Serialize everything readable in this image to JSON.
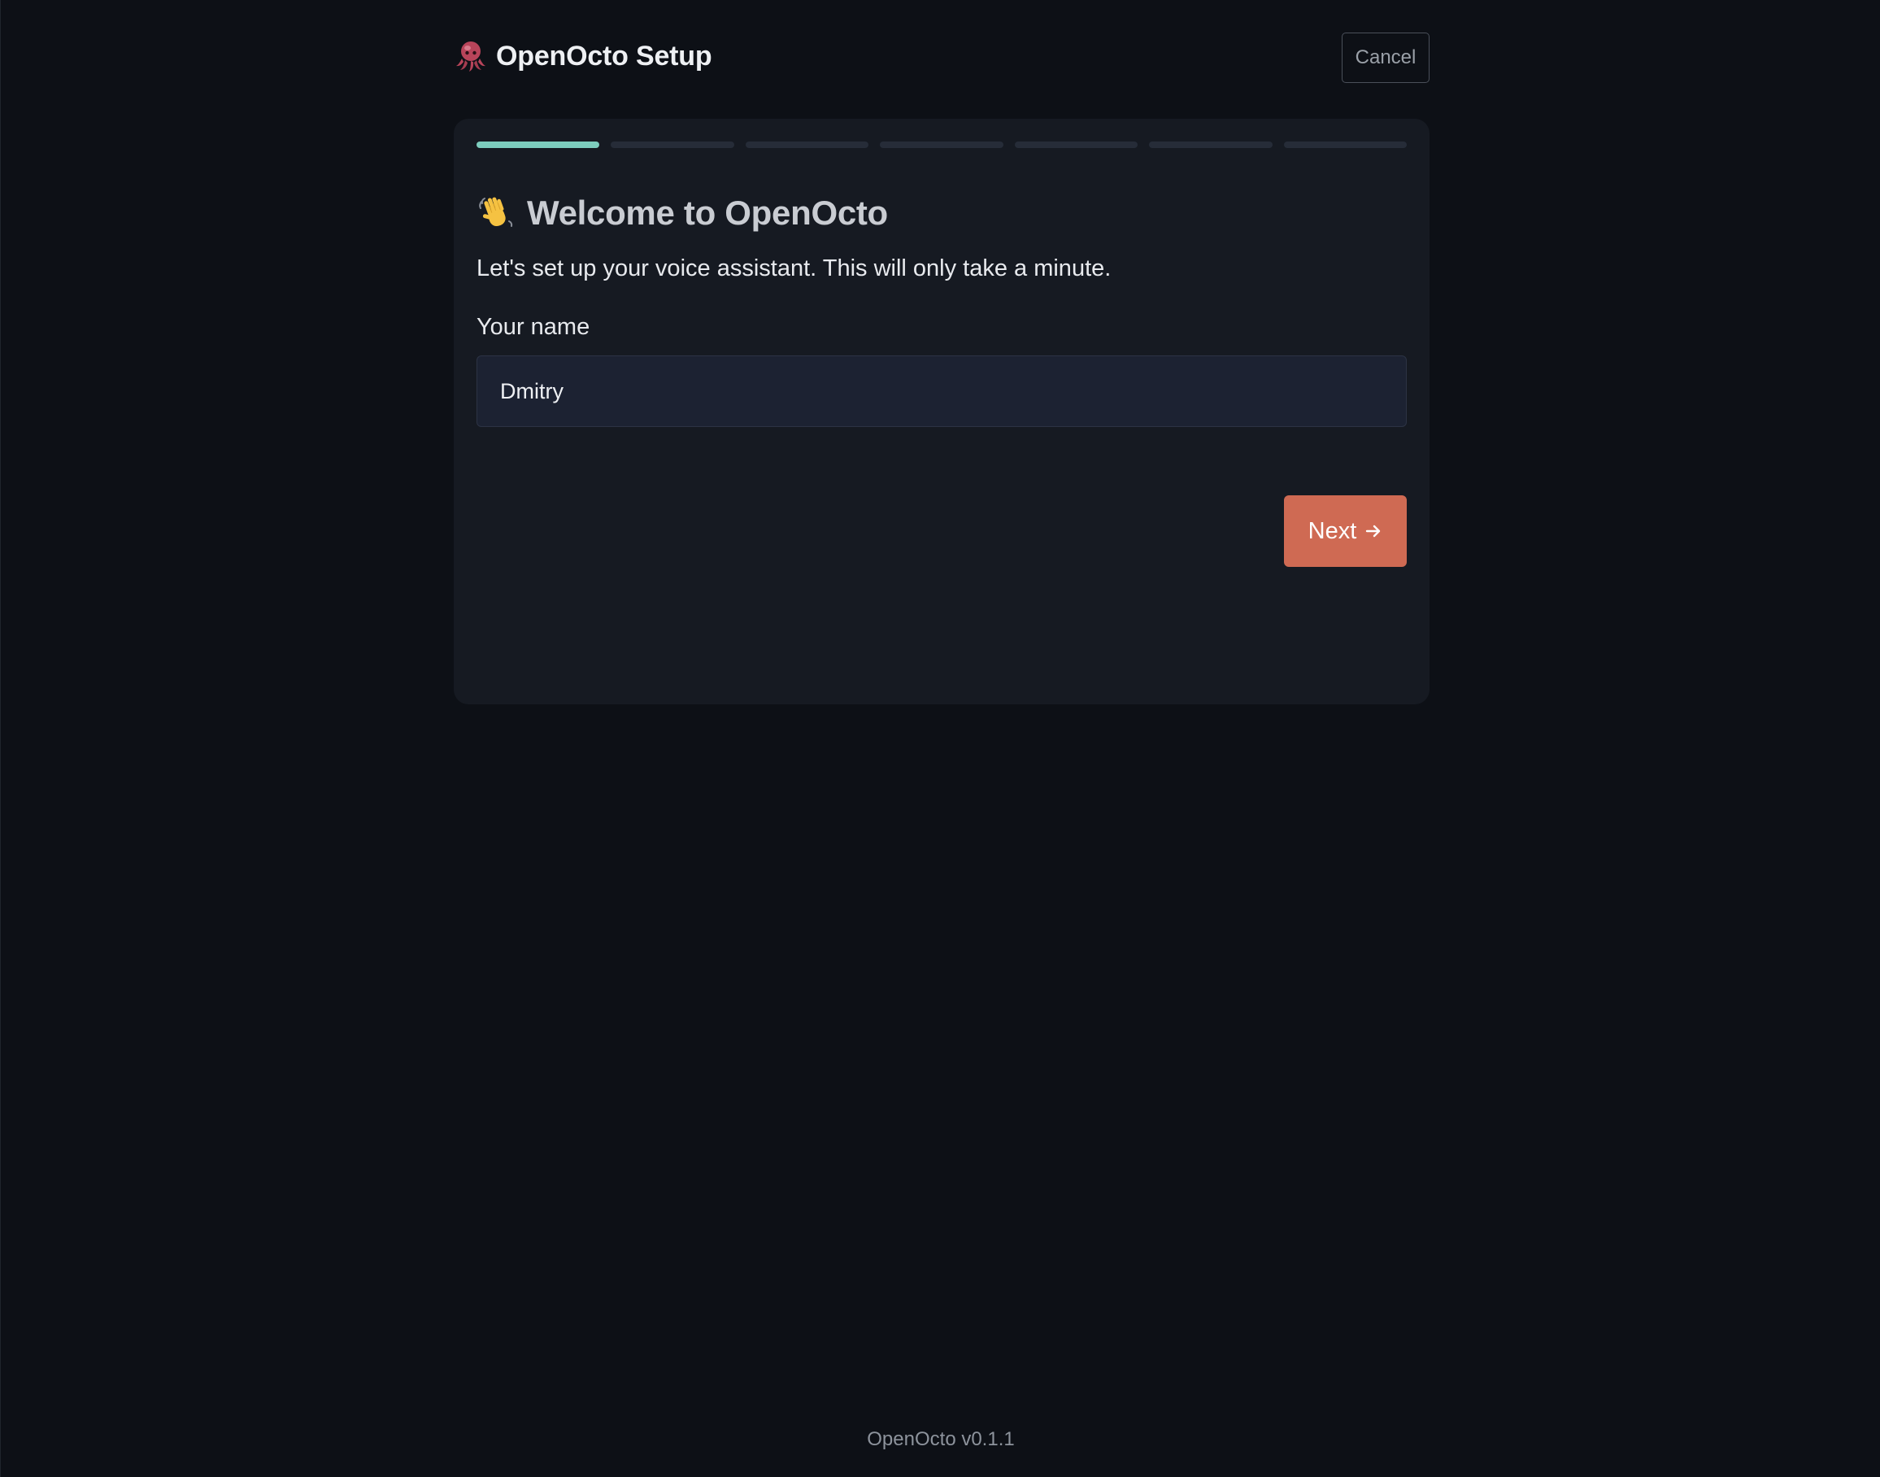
{
  "header": {
    "title": "OpenOcto Setup",
    "logo_icon": "octopus-icon",
    "cancel_label": "Cancel"
  },
  "wizard": {
    "steps_total": 7,
    "current_step": 1,
    "active_color": "#7dcdbe",
    "inactive_color": "#262c38"
  },
  "welcome": {
    "icon": "waving-hand-icon",
    "title": "Welcome to OpenOcto",
    "subtitle": "Let's set up your voice assistant. This will only take a minute."
  },
  "form": {
    "name_label": "Your name",
    "name_value": "Dmitry"
  },
  "actions": {
    "next_label": "Next",
    "next_icon": "arrow-right-icon",
    "accent_color": "#cf6a53"
  },
  "footer": {
    "version_text": "OpenOcto v0.1.1"
  }
}
